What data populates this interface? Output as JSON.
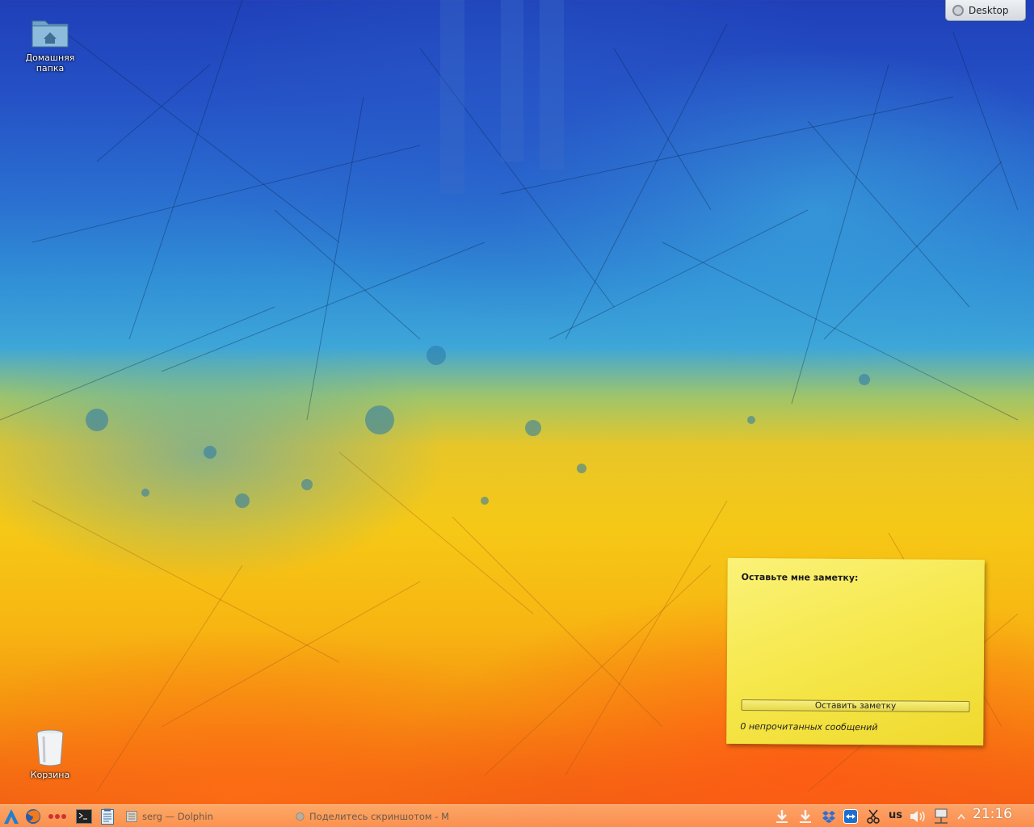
{
  "desktop": {
    "icons": [
      {
        "label": "Домашняя папка",
        "icon": "home-folder-icon"
      },
      {
        "label": "Корзина",
        "icon": "trash-icon"
      }
    ],
    "toolbox": {
      "label": "Desktop",
      "icon": "cashew-icon"
    }
  },
  "note_widget": {
    "title": "Оставьте мне заметку:",
    "button_label": "Оставить заметку",
    "status": "0 непрочитанных сообщений",
    "colors": {
      "paper": "#f6e84e",
      "button": "#ecdf5c"
    }
  },
  "taskbar": {
    "launchers": [
      {
        "name": "application-launcher-icon"
      },
      {
        "name": "firefox-icon"
      },
      {
        "name": "dots-icon"
      },
      {
        "name": "terminal-icon"
      },
      {
        "name": "clipboard-app-icon"
      }
    ],
    "tasks": [
      {
        "label": "serg — Dolphin",
        "icon": "dolphin-icon"
      },
      {
        "label": "Поделитесь скриншотом - М",
        "icon": "screenshot-app-icon"
      }
    ],
    "tray": {
      "keyboard_layout": "us",
      "clock": "21:16",
      "icons": [
        "download-icon",
        "download-icon",
        "dropbox-icon",
        "teamviewer-icon",
        "klipper-icon",
        "volume-icon",
        "network-icon",
        "tray-expand-icon"
      ]
    }
  }
}
